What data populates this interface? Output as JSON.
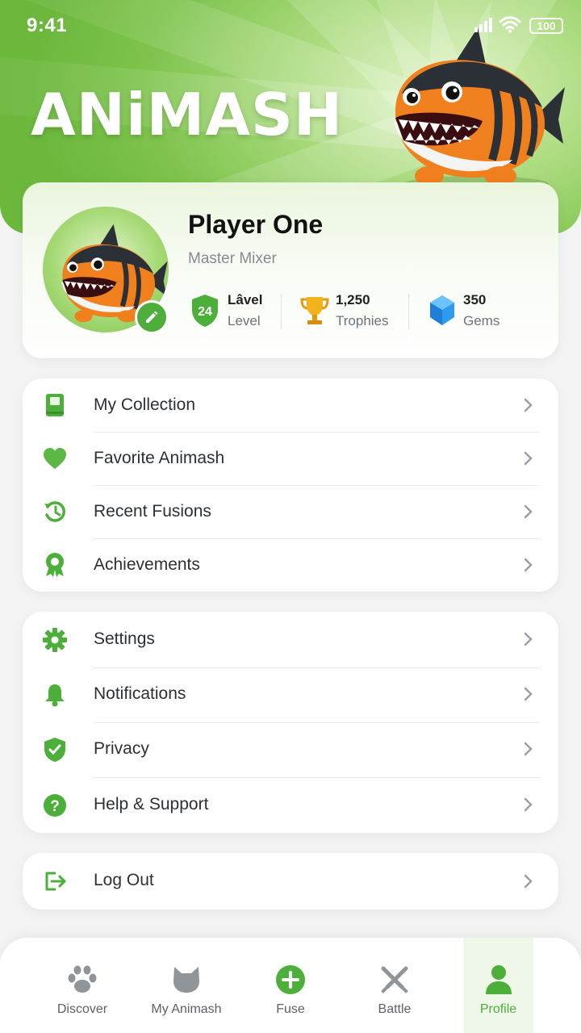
{
  "status_bar": {
    "time": "9:41",
    "battery": "100"
  },
  "app": {
    "logo": "ANiMASH"
  },
  "profile": {
    "name": "Player One",
    "title": "Master Mixer",
    "stats": [
      {
        "icon": "shield-level-icon",
        "badge": "24",
        "value": "Lâvel",
        "label": "Level"
      },
      {
        "icon": "trophy-icon",
        "value": "1,250",
        "label": "Trophies"
      },
      {
        "icon": "gem-icon",
        "value": "350",
        "label": "Gems"
      }
    ]
  },
  "menu_primary": [
    {
      "icon": "book-icon",
      "label": "My Collection"
    },
    {
      "icon": "heart-icon",
      "label": "Favorite Animash"
    },
    {
      "icon": "history-icon",
      "label": "Recent Fusions"
    },
    {
      "icon": "ribbon-award-icon",
      "label": "Achievements"
    }
  ],
  "menu_settings": [
    {
      "icon": "gear-icon",
      "label": "Settings"
    },
    {
      "icon": "bell-icon",
      "label": "Notifications"
    },
    {
      "icon": "shield-check-icon",
      "label": "Privacy"
    },
    {
      "icon": "question-icon",
      "label": "Help & Support"
    }
  ],
  "logout": {
    "icon": "logout-icon",
    "label": "Log Out"
  },
  "bottom_nav": [
    {
      "icon": "paw-icon",
      "label": "Discover"
    },
    {
      "icon": "cat-head-icon",
      "label": "My Animash"
    },
    {
      "icon": "plus-circle-icon",
      "label": "Fuse"
    },
    {
      "icon": "crossed-swords-icon",
      "label": "Battle"
    },
    {
      "icon": "person-icon",
      "label": "Profile",
      "active": true
    }
  ],
  "colors": {
    "accent": "#4caf3a",
    "hero_green": "#7cc24b",
    "text_dark": "#111111",
    "text_muted": "#858b90"
  }
}
